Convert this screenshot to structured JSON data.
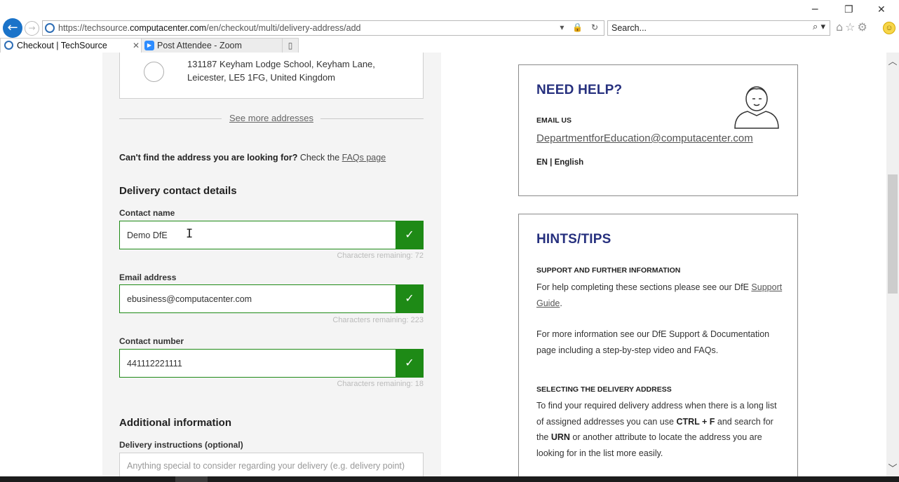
{
  "browser": {
    "url_prefix": "https://techsource.",
    "url_domain": "computacenter.com",
    "url_path": "/en/checkout/multi/delivery-address/add",
    "search_placeholder": "Search...",
    "tabs": [
      {
        "label": "Checkout | TechSource"
      },
      {
        "label": "Post Attendee - Zoom"
      }
    ]
  },
  "address": {
    "line": "131187 Keyham Lodge School, Keyham Lane, Leicester, LE5 1FG, United Kingdom"
  },
  "see_more": "See more addresses",
  "faq": {
    "bold": "Can't find the address you are looking for?",
    "text": " Check the ",
    "link": "FAQs page"
  },
  "contact": {
    "section_title": "Delivery contact details",
    "name_label": "Contact name",
    "name_value": "Demo DfE",
    "name_remaining": "Characters remaining: 72",
    "email_label": "Email address",
    "email_value": "ebusiness@computacenter.com",
    "email_remaining": "Characters remaining: 223",
    "phone_label": "Contact number",
    "phone_value": "441112221111",
    "phone_remaining": "Characters remaining: 18"
  },
  "additional": {
    "section_title": "Additional information",
    "instructions_label": "Delivery instructions (optional)",
    "instructions_placeholder": "Anything special to consider regarding your delivery (e.g. delivery point)"
  },
  "help": {
    "title": "NEED HELP?",
    "email_us": "EMAIL US",
    "email": "DepartmentforEducation@computacenter.com",
    "lang": "EN | English"
  },
  "tips": {
    "title": "HINTS/TIPS",
    "support_heading": "SUPPORT AND FURTHER INFORMATION",
    "support_text": "For help completing these sections please see our DfE ",
    "support_link": "Support Guide",
    "support_end": ".",
    "more_info": "For more information see our DfE Support & Documentation page including a step-by-step video and FAQs.",
    "select_heading": "SELECTING THE DELIVERY ADDRESS",
    "select_1": "To find your required delivery address when there is a long list of assigned addresses you can use ",
    "select_key": "CTRL + F",
    "select_2": " and search for the ",
    "select_urn": "URN",
    "select_3": " or another attribute to locate the address you are looking for in the list more easily."
  },
  "colors": {
    "valid_green": "#1e8a16",
    "heading_navy": "#26307e"
  }
}
